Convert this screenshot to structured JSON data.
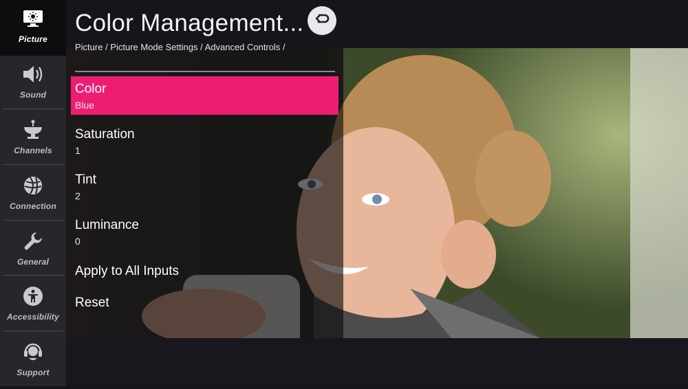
{
  "sidebar": {
    "items": [
      {
        "label": "Picture",
        "icon": "picture-icon",
        "active": true
      },
      {
        "label": "Sound",
        "icon": "speaker-icon",
        "active": false
      },
      {
        "label": "Channels",
        "icon": "satellite-dish-icon",
        "active": false
      },
      {
        "label": "Connection",
        "icon": "globe-icon",
        "active": false
      },
      {
        "label": "General",
        "icon": "wrench-icon",
        "active": false
      },
      {
        "label": "Accessibility",
        "icon": "accessibility-icon",
        "active": false
      },
      {
        "label": "Support",
        "icon": "headset-icon",
        "active": false
      }
    ]
  },
  "header": {
    "title": "Color Management...",
    "breadcrumb": "Picture / Picture Mode Settings / Advanced Controls /",
    "back_icon": "back-arrow-icon"
  },
  "menu": {
    "items": [
      {
        "label": "Color",
        "value": "Blue",
        "selected": true
      },
      {
        "label": "Saturation",
        "value": "1",
        "selected": false
      },
      {
        "label": "Tint",
        "value": "2",
        "selected": false
      },
      {
        "label": "Luminance",
        "value": "0",
        "selected": false
      },
      {
        "label": "Apply to All Inputs",
        "value": "",
        "selected": false
      },
      {
        "label": "Reset",
        "value": "",
        "selected": false
      }
    ]
  },
  "colors": {
    "accent": "#ee1d74",
    "sidebar_bg": "#27272b",
    "sidebar_active_bg": "#0d0d10",
    "background": "#15151b"
  }
}
